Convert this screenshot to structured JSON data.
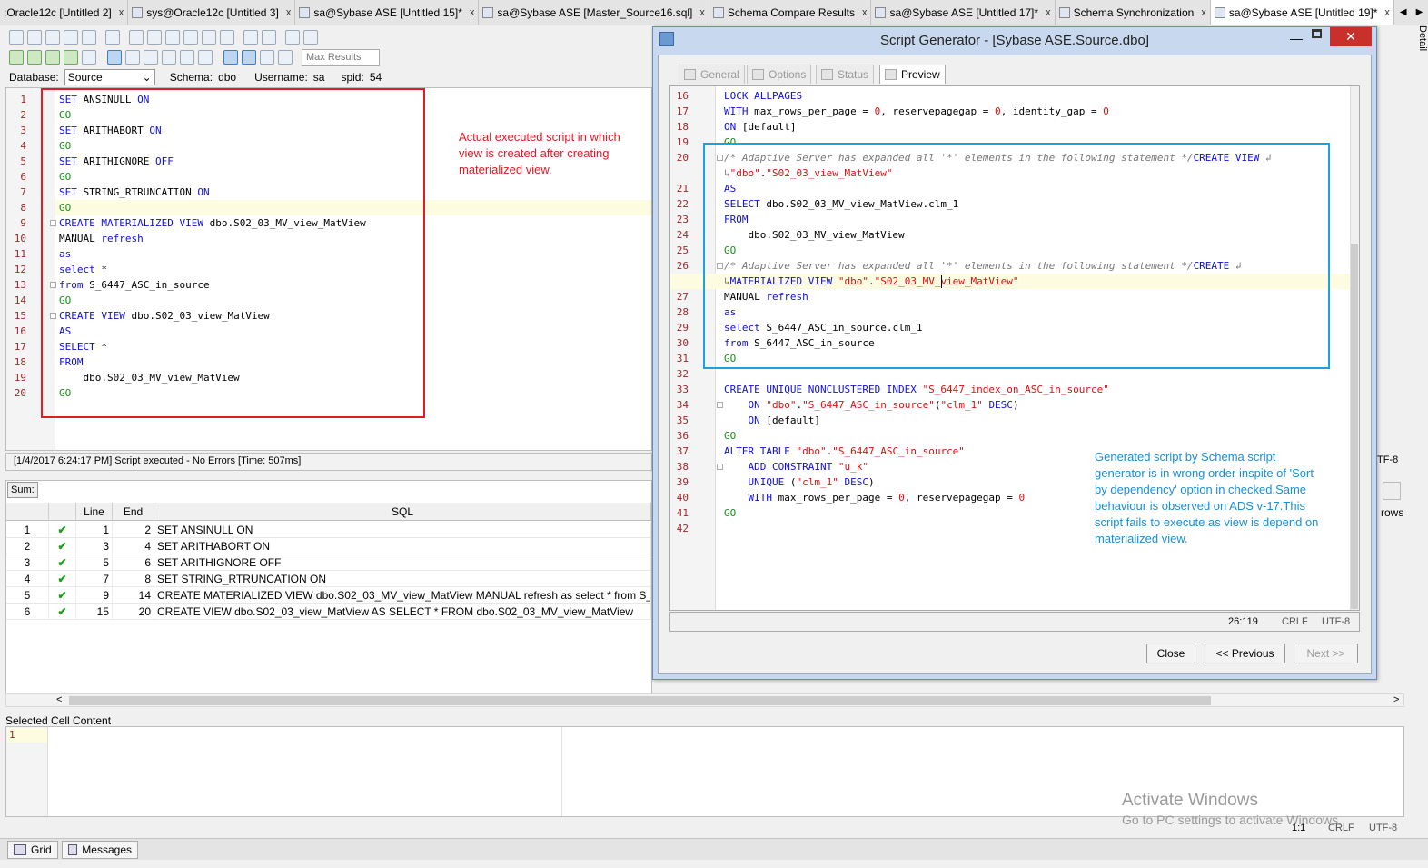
{
  "tabs": [
    {
      "label": ":Oracle12c [Untitled 2]"
    },
    {
      "label": "sys@Oracle12c [Untitled 3]"
    },
    {
      "label": "sa@Sybase ASE [Untitled 15]*"
    },
    {
      "label": "sa@Sybase ASE [Master_Source16.sql]"
    },
    {
      "label": "Schema Compare Results"
    },
    {
      "label": "sa@Sybase ASE [Untitled 17]*"
    },
    {
      "label": "Schema Synchronization"
    },
    {
      "label": "sa@Sybase ASE [Untitled 19]*"
    }
  ],
  "tab_close": "x",
  "nav": {
    "left": "◀",
    "right": "▶",
    "menu": "⊟"
  },
  "side_panel": "Detail",
  "toolbar": {
    "max_results_placeholder": "Max Results"
  },
  "connection": {
    "database_label": "Database:",
    "database_value": "Source",
    "schema_label": "Schema:",
    "schema_value": "dbo",
    "username_label": "Username:",
    "username_value": "sa",
    "spid_label": "spid:",
    "spid_value": "54"
  },
  "editor": {
    "lines": [
      {
        "n": "1",
        "html": "<span class=\"kw\">SET</span> ANSINULL <span class=\"kw\">ON</span>"
      },
      {
        "n": "2",
        "html": "<span class=\"go\">GO</span>"
      },
      {
        "n": "3",
        "html": "<span class=\"kw\">SET</span> ARITHABORT <span class=\"kw\">ON</span>"
      },
      {
        "n": "4",
        "html": "<span class=\"go\">GO</span>"
      },
      {
        "n": "5",
        "html": "<span class=\"kw\">SET</span> ARITHIGNORE <span class=\"kw\">OFF</span>"
      },
      {
        "n": "6",
        "html": "<span class=\"go\">GO</span>"
      },
      {
        "n": "7",
        "html": "<span class=\"kw\">SET</span> STRING_RTRUNCATION <span class=\"kw\">ON</span>"
      },
      {
        "n": "8",
        "html": "<span class=\"go\">GO</span>"
      },
      {
        "n": "9",
        "html": "<span class=\"kw\">CREATE MATERIALIZED VIEW</span> dbo.S02_03_MV_view_MatView"
      },
      {
        "n": "10",
        "html": "MANUAL <span class=\"kw\">refresh</span>"
      },
      {
        "n": "11",
        "html": "<span class=\"kw\">as</span>"
      },
      {
        "n": "12",
        "html": "<span class=\"kw\">select</span> *"
      },
      {
        "n": "13",
        "html": "<span class=\"kw\">from</span> S_6447_ASC_in_source"
      },
      {
        "n": "14",
        "html": "<span class=\"go\">GO</span>"
      },
      {
        "n": "15",
        "html": "<span class=\"kw\">CREATE VIEW</span> dbo.S02_03_view_MatView"
      },
      {
        "n": "16",
        "html": "<span class=\"kw\">AS</span>"
      },
      {
        "n": "17",
        "html": "<span class=\"kw\">SELECT</span> *"
      },
      {
        "n": "18",
        "html": "<span class=\"kw\">FROM</span>"
      },
      {
        "n": "19",
        "html": "    dbo.S02_03_MV_view_MatView"
      },
      {
        "n": "20",
        "html": "<span class=\"go\">GO</span>"
      }
    ]
  },
  "annotations": {
    "red": "Actual executed script in which view is  created after creating materialized view.",
    "blue": "Generated script by Schema script generator is in wrong order inspite of 'Sort by dependency' option in checked.Same behaviour is observed on ADS v-17.This script fails to execute as view is depend on materialized view."
  },
  "status_line": "[1/4/2017 6:24:17 PM] Script executed - No Errors [Time: 507ms]",
  "status_line_tail": "TF-8",
  "results": {
    "sum_label": "Sum:",
    "headers": {
      "line": "Line",
      "end": "End",
      "sql": "SQL"
    },
    "right_fragment": "rows",
    "rows": [
      {
        "idx": "1",
        "line": "1",
        "end": "2",
        "sql": "SET ANSINULL ON"
      },
      {
        "idx": "2",
        "line": "3",
        "end": "4",
        "sql": "SET ARITHABORT ON"
      },
      {
        "idx": "3",
        "line": "5",
        "end": "6",
        "sql": "SET ARITHIGNORE OFF"
      },
      {
        "idx": "4",
        "line": "7",
        "end": "8",
        "sql": "SET STRING_RTRUNCATION ON"
      },
      {
        "idx": "5",
        "line": "9",
        "end": "14",
        "sql": "CREATE MATERIALIZED VIEW dbo.S02_03_MV_view_MatView MANUAL refresh as select * from S_"
      },
      {
        "idx": "6",
        "line": "15",
        "end": "20",
        "sql": "CREATE VIEW dbo.S02_03_view_MatView AS SELECT * FROM dbo.S02_03_MV_view_MatView"
      }
    ]
  },
  "selected_cell": {
    "label": "Selected Cell Content",
    "line": "1"
  },
  "bottom_tabs": {
    "grid": "Grid",
    "messages": "Messages"
  },
  "watermark": {
    "title": "Activate Windows",
    "subtitle": "Go to PC settings to activate Windows."
  },
  "bottom_status": {
    "pos": "1:1",
    "eol": "CRLF",
    "enc": "UTF-8"
  },
  "dialog": {
    "title": "Script Generator - [Sybase ASE.Source.dbo]",
    "tabs": [
      {
        "label": "General"
      },
      {
        "label": "Options"
      },
      {
        "label": "Status"
      },
      {
        "label": "Preview"
      }
    ],
    "preview_lines": [
      {
        "n": "16",
        "html": "<span class=\"kw\">LOCK ALLPAGES</span>"
      },
      {
        "n": "17",
        "html": "<span class=\"kw\">WITH</span> max_rows_per_page = <span class=\"str\">0</span>, reservepagegap = <span class=\"str\">0</span>, identity_gap = <span class=\"str\">0</span>"
      },
      {
        "n": "18",
        "html": "<span class=\"kw\">ON</span> [default]"
      },
      {
        "n": "19",
        "html": "<span class=\"go\">GO</span>"
      },
      {
        "n": "20",
        "html": "<span class=\"cmt\">/* Adaptive Server has expanded all '*' elements in the following statement */</span><span class=\"kw\">CREATE VIEW</span> <span class=\"cmt\">↲</span>"
      },
      {
        "n": "",
        "html": "<span class=\"cmt\">↳</span><span class=\"str\">\"dbo\"</span>.<span class=\"str\">\"S02_03_view_MatView\"</span>"
      },
      {
        "n": "21",
        "html": "<span class=\"kw\">AS</span>"
      },
      {
        "n": "22",
        "html": "<span class=\"kw\">SELECT</span> dbo.S02_03_MV_view_MatView.clm_1"
      },
      {
        "n": "23",
        "html": "<span class=\"kw\">FROM</span>"
      },
      {
        "n": "24",
        "html": "    dbo.S02_03_MV_view_MatView"
      },
      {
        "n": "25",
        "html": "<span class=\"go\">GO</span>"
      },
      {
        "n": "26",
        "html": "<span class=\"cmt\">/* Adaptive Server has expanded all '*' elements in the following statement */</span><span class=\"kw\">CREATE</span> <span class=\"cmt\">↲</span>"
      },
      {
        "n": "",
        "html": "<span class=\"cmt\">↳</span><span class=\"kw\">MATERIALIZED VIEW</span> <span class=\"str\">\"dbo\"</span>.<span class=\"str\">\"S02_03_MV_view_MatView\"</span>"
      },
      {
        "n": "27",
        "html": "MANUAL <span class=\"kw\">refresh</span>"
      },
      {
        "n": "28",
        "html": "<span class=\"kw\">as</span>"
      },
      {
        "n": "29",
        "html": "<span class=\"kw\">select</span> S_6447_ASC_in_source.clm_1"
      },
      {
        "n": "30",
        "html": "<span class=\"kw\">from</span> S_6447_ASC_in_source"
      },
      {
        "n": "31",
        "html": "<span class=\"go\">GO</span>"
      },
      {
        "n": "32",
        "html": ""
      },
      {
        "n": "33",
        "html": "<span class=\"kw\">CREATE UNIQUE NONCLUSTERED INDEX</span> <span class=\"str\">\"S_6447_index_on_ASC_in_source\"</span>"
      },
      {
        "n": "34",
        "html": "    <span class=\"kw\">ON</span> <span class=\"str\">\"dbo\"</span>.<span class=\"str\">\"S_6447_ASC_in_source\"</span>(<span class=\"str\">\"clm_1\"</span> <span class=\"kw\">DESC</span>)"
      },
      {
        "n": "35",
        "html": "    <span class=\"kw\">ON</span> [default]"
      },
      {
        "n": "36",
        "html": "<span class=\"go\">GO</span>"
      },
      {
        "n": "37",
        "html": "<span class=\"kw\">ALTER TABLE</span> <span class=\"str\">\"dbo\"</span>.<span class=\"str\">\"S_6447_ASC_in_source\"</span>"
      },
      {
        "n": "38",
        "html": "    <span class=\"kw\">ADD CONSTRAINT</span> <span class=\"str\">\"u_k\"</span>"
      },
      {
        "n": "39",
        "html": "    <span class=\"kw\">UNIQUE</span> (<span class=\"str\">\"clm_1\"</span> <span class=\"kw\">DESC</span>)"
      },
      {
        "n": "40",
        "html": "    <span class=\"kw\">WITH</span> max_rows_per_page = <span class=\"str\">0</span>, reservepagegap = <span class=\"str\">0</span>"
      },
      {
        "n": "41",
        "html": "<span class=\"go\">GO</span>"
      },
      {
        "n": "42",
        "html": ""
      }
    ],
    "status": {
      "pos": "26:119",
      "eol": "CRLF",
      "enc": "UTF-8"
    },
    "buttons": {
      "close": "Close",
      "previous": "<< Previous",
      "next": "Next >>"
    },
    "win_min": "—",
    "win_close": "✕"
  }
}
